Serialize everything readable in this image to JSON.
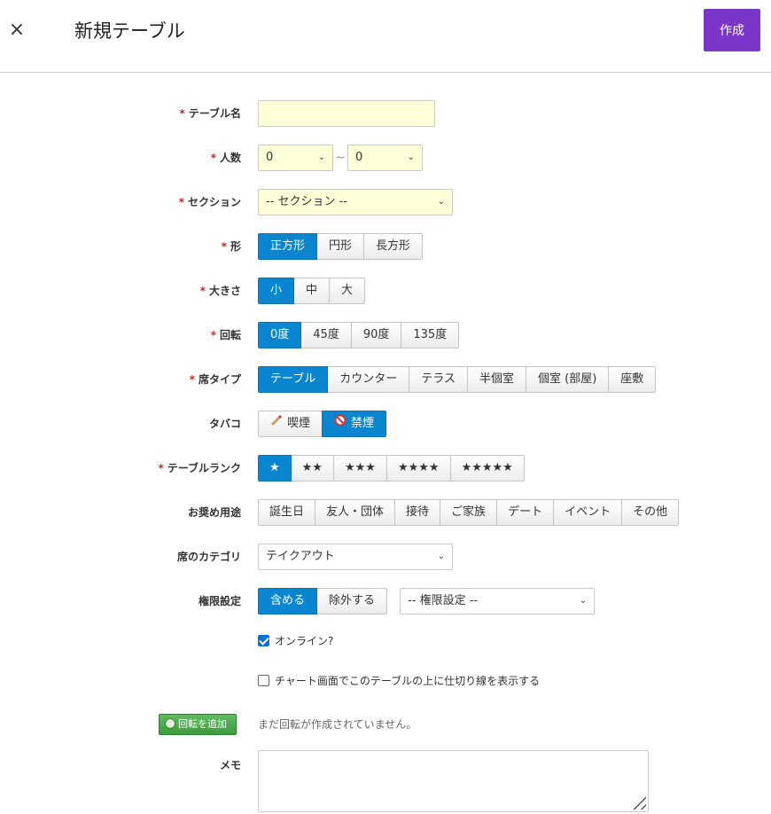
{
  "header": {
    "close_icon": "×",
    "title": "新規テーブル",
    "create_label": "作成"
  },
  "form": {
    "required_mark": "*",
    "table_name": {
      "label": "テーブル名",
      "value": ""
    },
    "people": {
      "label": "人数",
      "min": "0",
      "max": "0",
      "separator": "~"
    },
    "section": {
      "label": "セクション",
      "value": "-- セクション --"
    },
    "shape": {
      "label": "形",
      "options": [
        "正方形",
        "円形",
        "長方形"
      ],
      "selected": 0
    },
    "size": {
      "label": "大きさ",
      "options": [
        "小",
        "中",
        "大"
      ],
      "selected": 0
    },
    "rotation": {
      "label": "回転",
      "options": [
        "0度",
        "45度",
        "90度",
        "135度"
      ],
      "selected": 0
    },
    "seat_type": {
      "label": "席タイプ",
      "options": [
        "テーブル",
        "カウンター",
        "テラス",
        "半個室",
        "個室 (部屋)",
        "座敷"
      ],
      "selected": 0
    },
    "tobacco": {
      "label": "タバコ",
      "options": [
        "喫煙",
        "禁煙"
      ],
      "selected": 1,
      "icons": [
        "cigarette-icon",
        "no-smoking-icon"
      ]
    },
    "table_rank": {
      "label": "テーブルランク",
      "options": [
        "★",
        "★★",
        "★★★",
        "★★★★",
        "★★★★★"
      ],
      "selected": 0
    },
    "recommended_use": {
      "label": "お奨め用途",
      "options": [
        "誕生日",
        "友人・団体",
        "接待",
        "ご家族",
        "デート",
        "イベント",
        "その他"
      ]
    },
    "seat_category": {
      "label": "席のカテゴリ",
      "value": "テイクアウト"
    },
    "permission": {
      "label": "権限設定",
      "options": [
        "含める",
        "除外する"
      ],
      "selected": 0,
      "select_value": "-- 権限設定 --"
    },
    "online": {
      "label": "オンライン?",
      "checked": true
    },
    "divider": {
      "label": "チャート画面でこのテーブルの上に仕切り線を表示する",
      "checked": false
    },
    "add_rotation": {
      "label": "回転を追加",
      "message": "まだ回転が作成されていません。"
    },
    "memo": {
      "label": "メモ",
      "value": ""
    }
  },
  "colors": {
    "accent": "#7b35c9",
    "active": "#0a86d0",
    "input_bg": "#ffffd8",
    "required": "#b03030",
    "add_button": "#3c9b3c"
  }
}
